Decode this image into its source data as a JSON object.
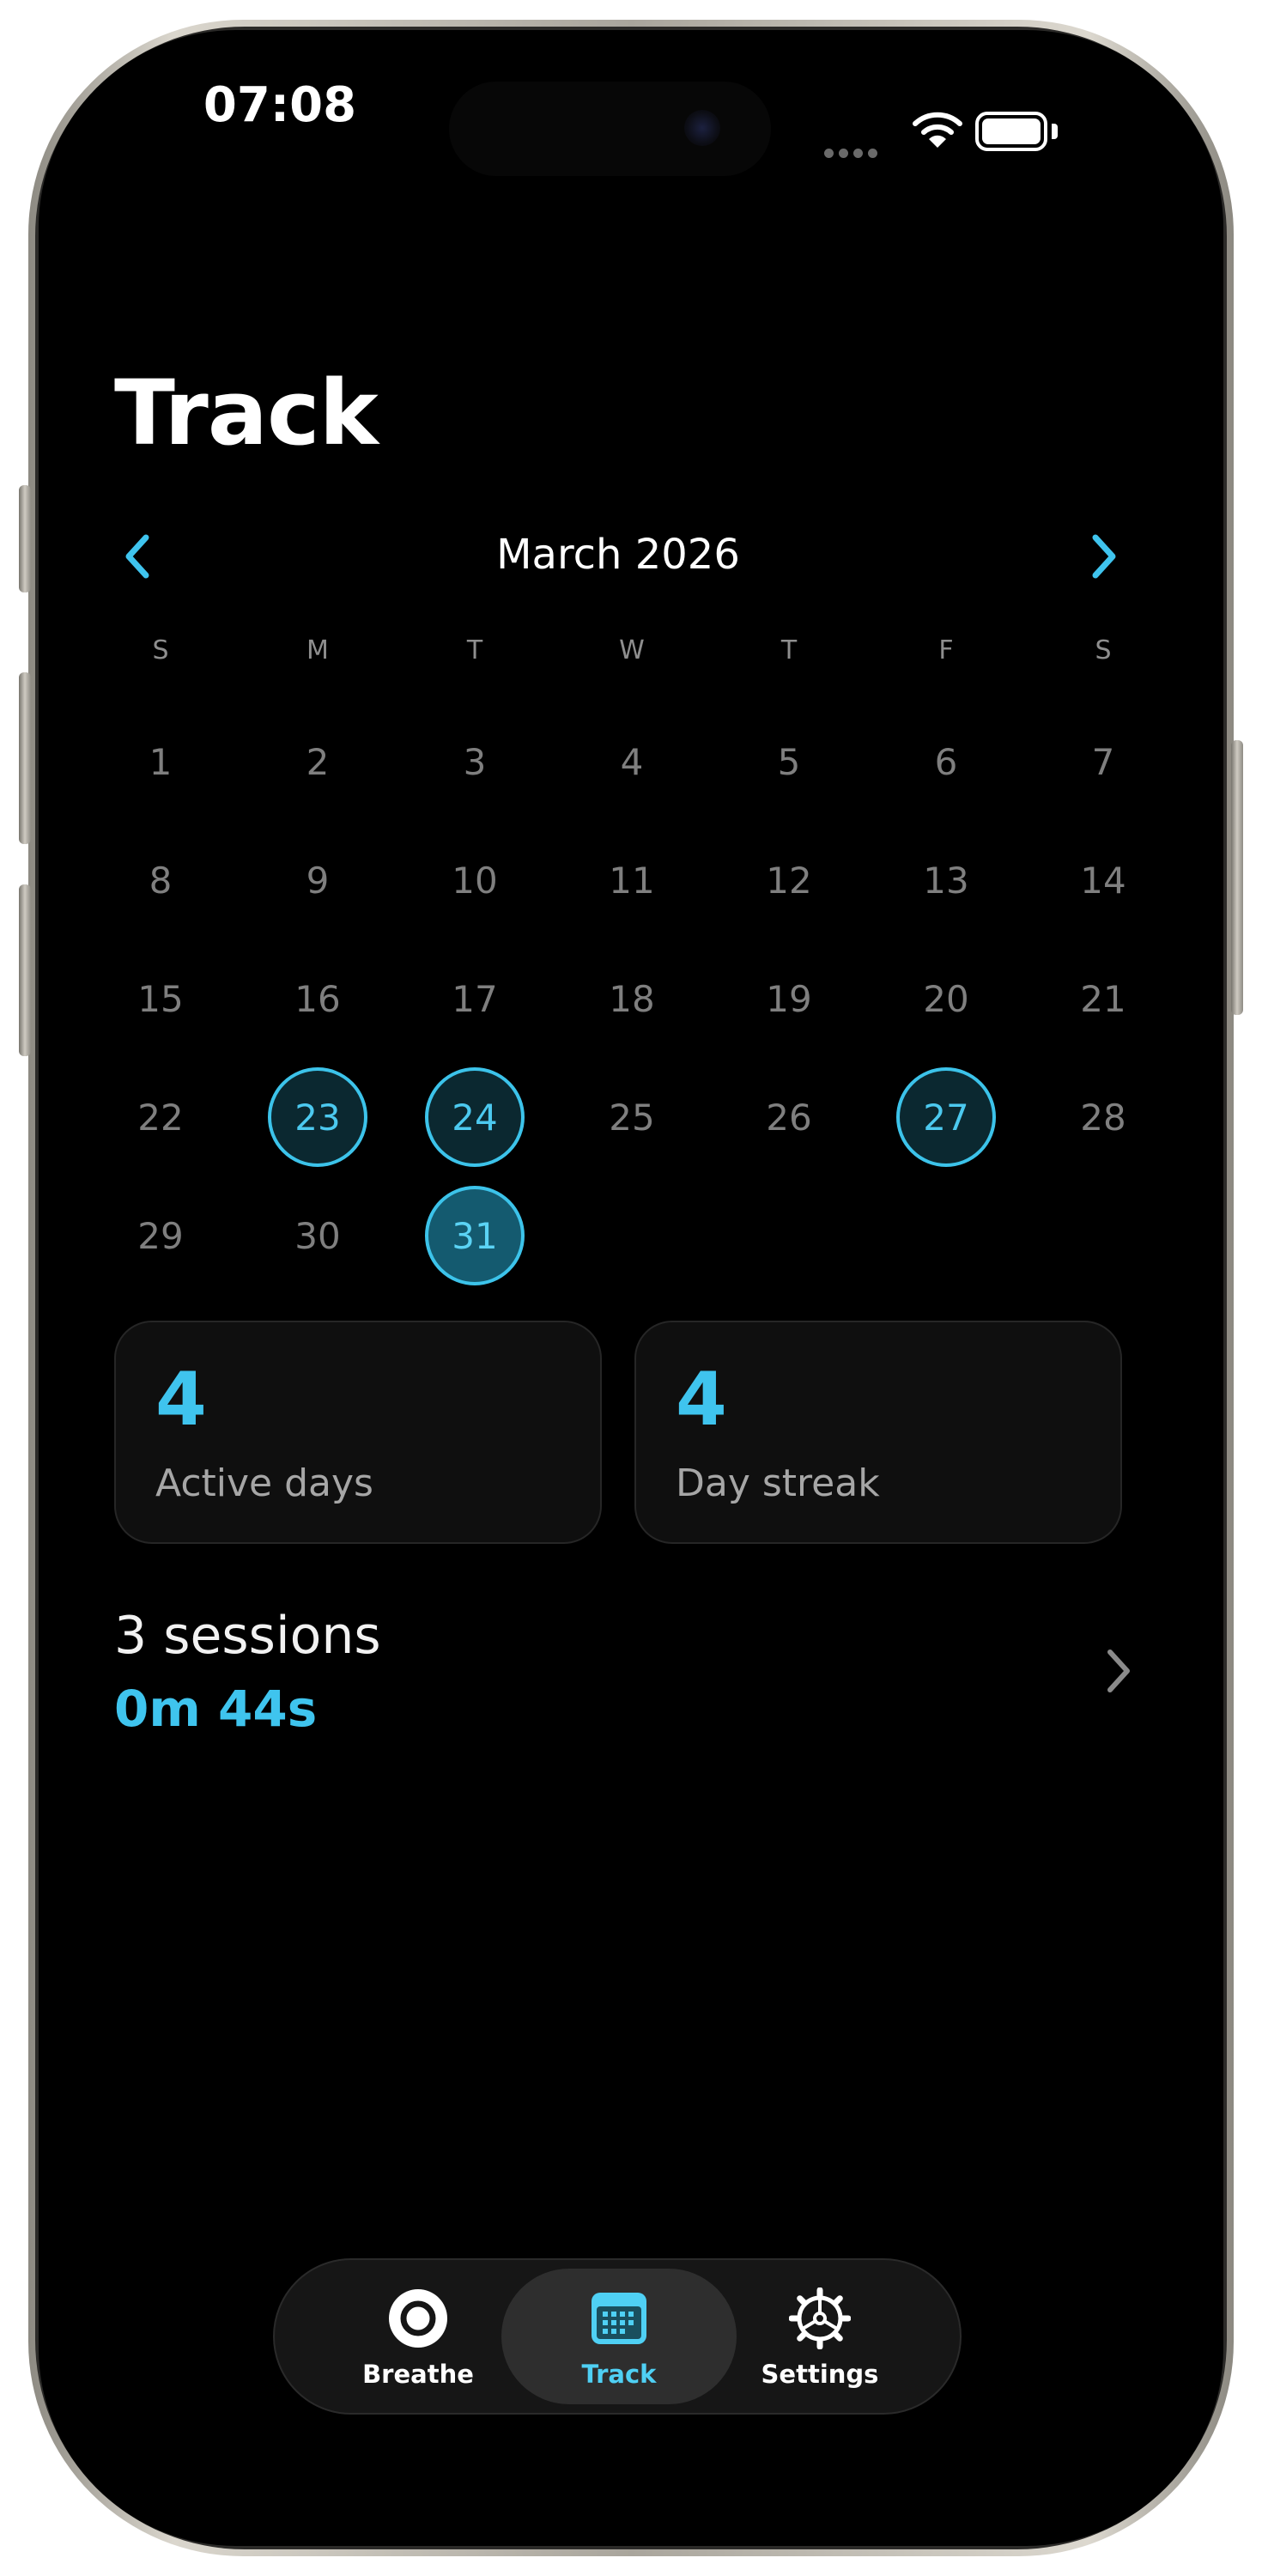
{
  "status_bar": {
    "time": "07:08"
  },
  "header": {
    "title": "Track"
  },
  "calendar": {
    "month_label": "March 2026",
    "weekdays": [
      "S",
      "M",
      "T",
      "W",
      "T",
      "F",
      "S"
    ],
    "days": [
      "1",
      "2",
      "3",
      "4",
      "5",
      "6",
      "7",
      "8",
      "9",
      "10",
      "11",
      "12",
      "13",
      "14",
      "15",
      "16",
      "17",
      "18",
      "19",
      "20",
      "21",
      "22",
      "23",
      "24",
      "25",
      "26",
      "27",
      "28",
      "29",
      "30",
      "31"
    ],
    "active_days": [
      "23",
      "24",
      "27",
      "31"
    ],
    "today": "31"
  },
  "stats": {
    "active_days": {
      "value": "4",
      "label": "Active days"
    },
    "day_streak": {
      "value": "4",
      "label": "Day streak"
    }
  },
  "sessions": {
    "title": "3 sessions",
    "duration": "0m 44s"
  },
  "tabbar": {
    "tabs": [
      {
        "label": "Breathe",
        "icon": "breathe-circle-icon"
      },
      {
        "label": "Track",
        "icon": "calendar-icon",
        "selected": true
      },
      {
        "label": "Settings",
        "icon": "gear-icon"
      }
    ]
  },
  "colors": {
    "accent": "#3fc4ee",
    "background": "#000000",
    "card": "#0f0f0f"
  }
}
